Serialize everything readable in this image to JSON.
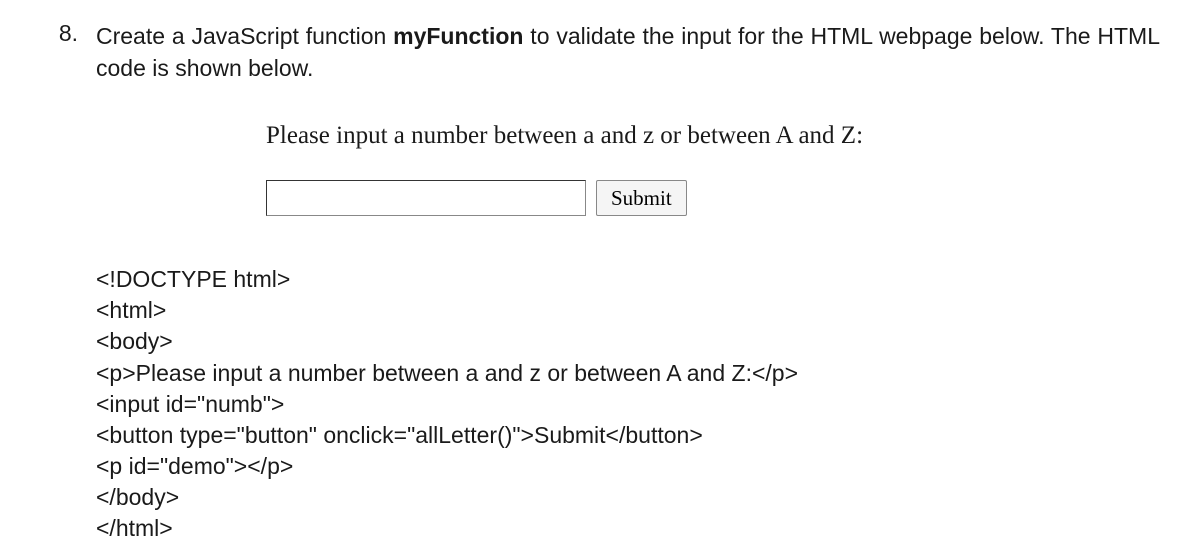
{
  "question": {
    "number": "8.",
    "text_before_bold": "Create a JavaScript function ",
    "bold_text": "myFunction",
    "text_after_bold": " to validate the input for the HTML webpage below.  The HTML code is shown below."
  },
  "preview": {
    "label": "Please input a number between a and z or between A and Z:",
    "input_value": "",
    "button_label": "Submit"
  },
  "code": {
    "lines": [
      "<!DOCTYPE html>",
      "<html>",
      "<body>",
      "<p>Please input a number between a and z or between A and Z:</p>",
      "<input id=\"numb\">",
      "<button type=\"button\" onclick=\"allLetter()\">Submit</button>",
      "<p id=\"demo\"></p>",
      "</body>",
      "</html>"
    ]
  }
}
